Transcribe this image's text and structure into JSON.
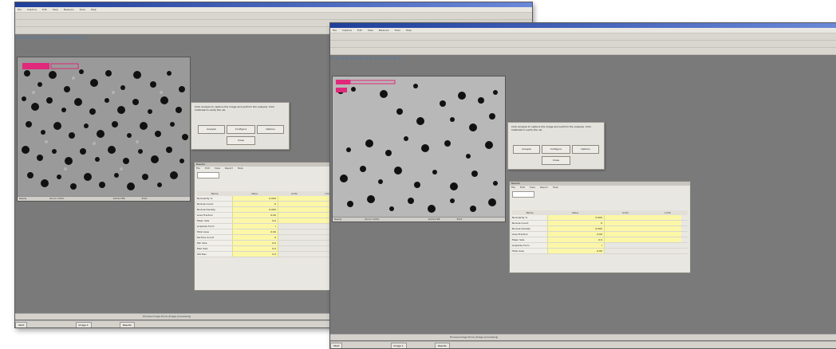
{
  "app": {
    "menu": [
      "File",
      "Capture",
      "Edit",
      "View",
      "Measure",
      "Tools",
      "Help"
    ]
  },
  "left_window": {
    "image_status": [
      "Ready",
      "Zoom 100%",
      "1024x768",
      "8 bit"
    ],
    "dialog": {
      "message": "Click Analyze to capture the image and perform the analysis. Click Calibrate to verify the cal.",
      "buttons": [
        "Analyze",
        "Configure",
        "Options",
        "Close"
      ]
    },
    "panel": {
      "title": "Results",
      "menu": [
        "File",
        "Edit",
        "View",
        "Report",
        "Help"
      ],
      "headers": [
        "Name",
        "Value",
        "Units",
        "Limit"
      ],
      "rows": [
        {
          "label": "Nodularity %",
          "value": "0.000"
        },
        {
          "label": "Nodule Count",
          "value": "0"
        },
        {
          "label": "Nodule Density",
          "value": "0.000"
        },
        {
          "label": "Area Fraction",
          "value": "0.00"
        },
        {
          "label": "Mean Size",
          "value": "0.0"
        },
        {
          "label": "Graphite Form",
          "value": "I"
        },
        {
          "label": "Total Area",
          "value": "0.00"
        },
        {
          "label": "Particle Count",
          "value": "0"
        },
        {
          "label": "Min Size",
          "value": "0.0"
        },
        {
          "label": "Max Size",
          "value": "0.0"
        },
        {
          "label": "Std Dev",
          "value": "0.0"
        }
      ]
    },
    "statusbar": "Process Image Done (image processing)",
    "taskbar": [
      "Start",
      "Image 1",
      "Results"
    ]
  },
  "right_window": {
    "image_status": [
      "Ready",
      "Zoom 100%",
      "1024x768",
      "8 bit"
    ],
    "dialog": {
      "message": "Click Analyze to capture the image and perform the analysis. Click Calibrate to verify the cal.",
      "buttons": [
        "Analyze",
        "Configure",
        "Options",
        "Close"
      ]
    },
    "panel": {
      "title": "Results",
      "menu": [
        "File",
        "Edit",
        "View",
        "Report",
        "Help"
      ],
      "headers": [
        "Name",
        "Value",
        "Units",
        "Limit"
      ],
      "rows": [
        {
          "label": "Nodularity %",
          "value": "0.000"
        },
        {
          "label": "Nodule Count",
          "value": "0"
        },
        {
          "label": "Nodule Density",
          "value": "0.000"
        },
        {
          "label": "Area Fraction",
          "value": "0.00"
        },
        {
          "label": "Mean Size",
          "value": "0.0"
        },
        {
          "label": "Graphite Form",
          "value": "I"
        },
        {
          "label": "Total Area",
          "value": "0.00"
        }
      ]
    },
    "statusbar": "Process Image Done (image processing)",
    "taskbar": [
      "Start",
      "Image 1",
      "Results"
    ]
  },
  "colors": {
    "title_blue": "#1f3f9a",
    "workspace": "#7a7a7a",
    "highlight_cell": "#fbf7a6",
    "magenta_marker": "#e0297a"
  }
}
